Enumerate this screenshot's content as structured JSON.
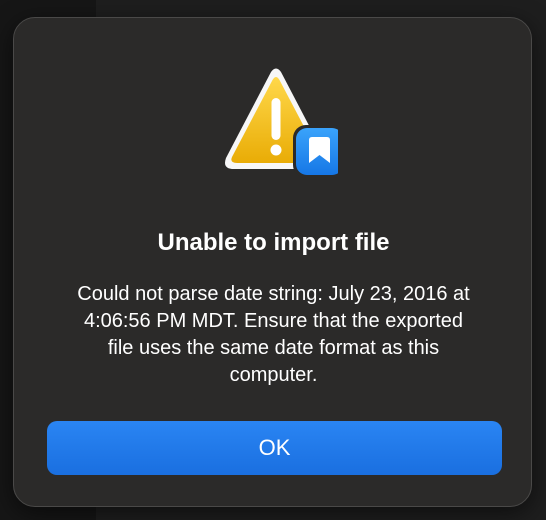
{
  "alert": {
    "title": "Unable to import file",
    "message": "Could not parse date string: July 23, 2016 at 4:06:56 PM MDT. Ensure that the exported file uses the same date format as this computer.",
    "ok_label": "OK",
    "icon": "warning-triangle-icon",
    "badge_icon": "bookmark-book-icon"
  },
  "colors": {
    "dialog_background": "#2b2a29",
    "button_accent": "#1a6fe0",
    "warning_yellow": "#f4c21f",
    "badge_blue": "#1e8df0"
  }
}
